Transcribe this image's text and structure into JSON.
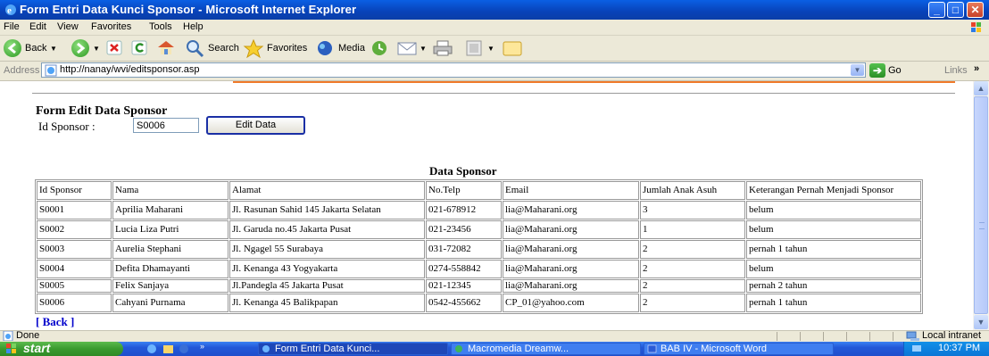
{
  "window": {
    "title": "Form Entri Data Kunci Sponsor - Microsoft Internet Explorer",
    "icon": "ie-icon"
  },
  "menu": [
    "File",
    "Edit",
    "View",
    "Favorites",
    "Tools",
    "Help"
  ],
  "toolbar": {
    "back": "Back",
    "search": "Search",
    "favorites": "Favorites",
    "media": "Media"
  },
  "address": {
    "label": "Address",
    "url": "http://nanay/wvi/editsponsor.asp",
    "go": "Go",
    "links": "Links"
  },
  "page": {
    "form_title": "Form Edit Data Sponsor",
    "id_label": "Id Sponsor :",
    "id_value": "S0006",
    "edit_button": "Edit Data",
    "table_title": "Data Sponsor",
    "headers": [
      "Id Sponsor",
      "Nama",
      "Alamat",
      "No.Telp",
      "Email",
      "Jumlah Anak Asuh",
      "Keterangan Pernah Menjadi Sponsor"
    ],
    "rows": [
      [
        "S0001",
        "Aprilia Maharani",
        "Jl. Rasunan Sahid 145 Jakarta Selatan",
        "021-678912",
        "lia@Maharani.org",
        "3",
        "belum"
      ],
      [
        "S0002",
        "Lucia Liza Putri",
        "Jl. Garuda no.45 Jakarta Pusat",
        "021-23456",
        "lia@Maharani.org",
        "1",
        "belum"
      ],
      [
        "S0003",
        "Aurelia Stephani",
        "Jl. Ngagel 55 Surabaya",
        "031-72082",
        "lia@Maharani.org",
        "2",
        "pernah 1 tahun"
      ],
      [
        "S0004",
        "Defita Dhamayanti",
        "Jl. Kenanga 43 Yogyakarta",
        "0274-558842",
        "lia@Maharani.org",
        "2",
        "belum"
      ],
      [
        "S0005",
        "Felix Sanjaya",
        "Jl.Pandegla 45 Jakarta Pusat",
        "021-12345",
        "lia@Maharani.org",
        "2",
        "pernah 2 tahun"
      ],
      [
        "S0006",
        "Cahyani Purnama",
        "Jl. Kenanga 45 Balikpapan",
        "0542-455662",
        "CP_01@yahoo.com",
        "2",
        "pernah 1 tahun"
      ]
    ],
    "back_link": "[ Back ]"
  },
  "status": {
    "text": "Done",
    "zone": "Local intranet"
  },
  "taskbar": {
    "start": "start",
    "tasks": [
      "Form Entri Data Kunci...",
      "Macromedia Dreamw...",
      "BAB IV - Microsoft Word"
    ],
    "clock": "10:37 PM"
  },
  "colors": {
    "titlebar": "#0842b8",
    "accent_stripe": "#f07a2a",
    "link": "#0000cc",
    "taskbar": "#2358d8",
    "start": "#3a9a2f"
  }
}
